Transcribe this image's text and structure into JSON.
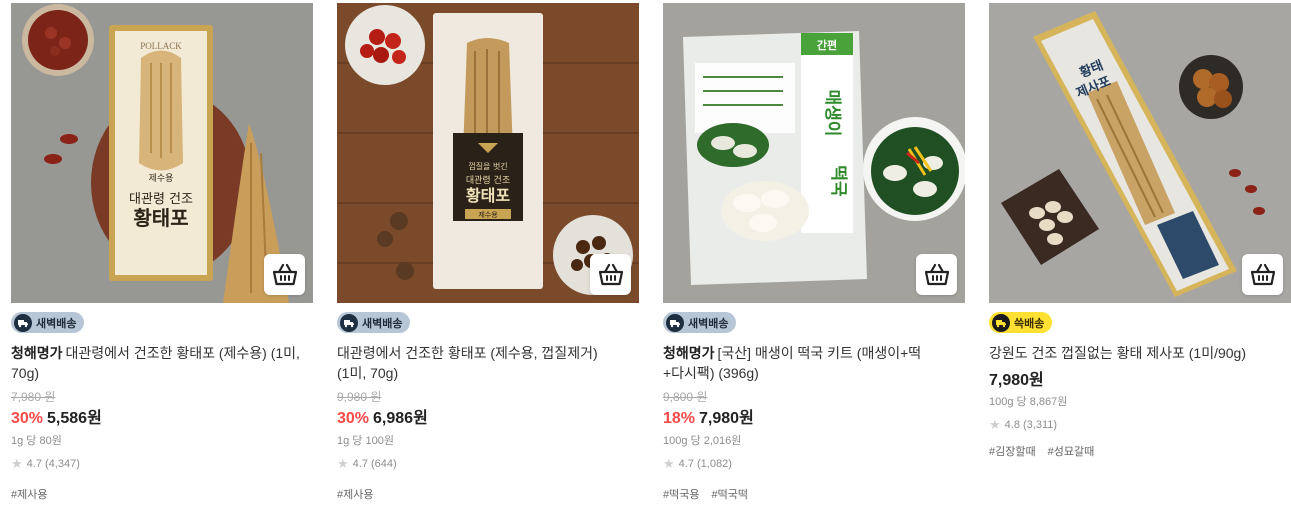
{
  "products": [
    {
      "delivery_badge": "새벽배송",
      "brand": "청해명가",
      "title": "대관령에서 건조한 황태포 (제수용) (1미, 70g)",
      "original_price": "7,980 원",
      "discount_rate": "30%",
      "price": "5,586원",
      "unit_price": "1g 당 80원",
      "rating": "4.7 (4,347)",
      "tags": [
        "#제사용"
      ],
      "package_text": {
        "line1": "POLLACK",
        "line2": "제수용",
        "line3": "대관령 건조",
        "line4": "황태포"
      }
    },
    {
      "delivery_badge": "새벽배송",
      "brand": "",
      "title": "대관령에서 건조한 황태포 (제수용, 껍질제거) (1미, 70g)",
      "original_price": "9,980 원",
      "discount_rate": "30%",
      "price": "6,986원",
      "unit_price": "1g 당 100원",
      "rating": "4.7 (644)",
      "tags": [
        "#제사용"
      ],
      "package_text": {
        "line1": "껍질을 벗긴",
        "line2": "대관령 건조",
        "line3": "황태포",
        "line4": "제수용"
      }
    },
    {
      "delivery_badge": "새벽배송",
      "brand": "청해명가",
      "title": "[국산] 매생이 떡국 키트 (매생이+떡+다시팩) (396g)",
      "original_price": "9,800 원",
      "discount_rate": "18%",
      "price": "7,980원",
      "unit_price": "100g 당 2,016원",
      "rating": "4.7 (1,082)",
      "tags": [
        "#떡국용",
        "#떡국떡"
      ],
      "package_text": {
        "line1": "간편",
        "line2": "매생이",
        "line3": "떡국"
      }
    },
    {
      "delivery_badge": "쓱배송",
      "brand": "",
      "title": "강원도 건조 껍질없는 황태 제사포 (1미/90g)",
      "original_price": "",
      "discount_rate": "",
      "price": "7,980원",
      "unit_price": "100g 당 8,867원",
      "rating": "4.8 (3,311)",
      "tags": [
        "#김장할때",
        "#성묘갈때"
      ],
      "package_text": {
        "line1": "황태",
        "line2": "제사포"
      }
    }
  ],
  "icons": {
    "cart": "basket-icon",
    "delivery": "truck-icon",
    "rating": "star-icon"
  },
  "colors": {
    "discount": "#fa4a4a",
    "dawn_badge": "#b7c6d6",
    "quick_badge": "#ffe033"
  }
}
